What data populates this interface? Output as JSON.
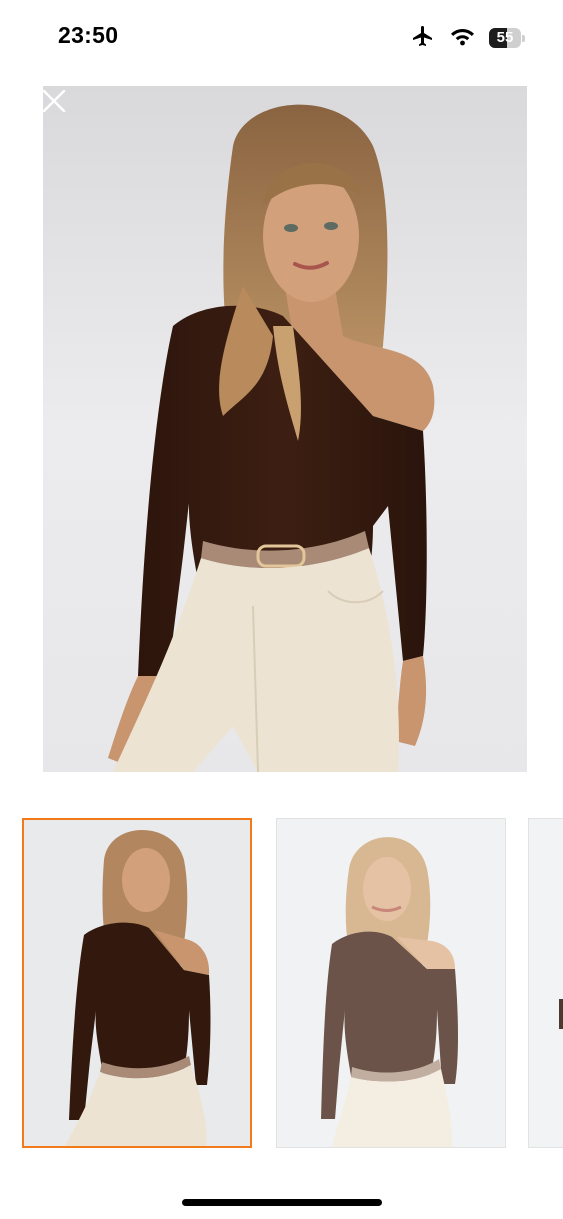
{
  "status_bar": {
    "time": "23:50",
    "battery_percent": "55",
    "battery_level": 0.55,
    "icons": [
      "airplane-icon",
      "wifi-icon",
      "battery-icon"
    ]
  },
  "gallery": {
    "close_icon": "close-icon",
    "selected_index": 0,
    "thumbnail_count_visible": 3,
    "accent_color": "#f27a1a"
  }
}
